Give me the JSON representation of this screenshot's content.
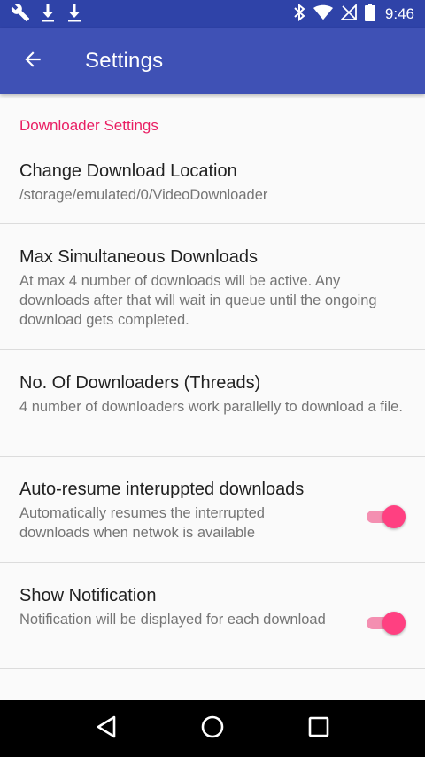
{
  "status_bar": {
    "time": "9:46",
    "left_icons": [
      "wrench-icon",
      "download-icon",
      "download-icon"
    ],
    "right_icons": [
      "bluetooth-icon",
      "wifi-icon",
      "no-signal-icon",
      "battery-icon"
    ]
  },
  "app_bar": {
    "title": "Settings",
    "color": "#3f51b5",
    "status_color": "#2f43a8"
  },
  "category": {
    "label": "Downloader Settings",
    "color": "#e91e63"
  },
  "prefs": [
    {
      "title": "Change Download Location",
      "summary": "/storage/emulated/0/VideoDownloader"
    },
    {
      "title": "Max Simultaneous Downloads",
      "summary": "At max 4 number of downloads will be active. Any downloads after that will wait in queue until the ongoing download gets completed."
    },
    {
      "title": "No. Of Downloaders (Threads)",
      "summary": "4 number of downloaders work parallelly to download a file."
    },
    {
      "title": "Auto-resume interuppted downloads",
      "summary": "Automatically resumes the interrupted downloads when netwok is available",
      "switch_on": true
    },
    {
      "title": "Show Notification",
      "summary": "Notification will be displayed for each download",
      "switch_on": true
    }
  ],
  "accent_color": "#ff4081",
  "nav_bar": [
    "back-icon",
    "home-icon",
    "recents-icon"
  ]
}
